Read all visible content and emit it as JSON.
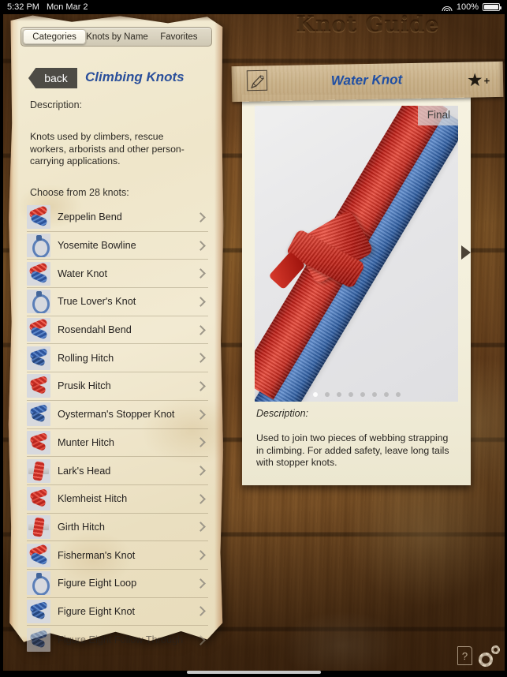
{
  "status_bar": {
    "time": "5:32 PM",
    "date": "Mon Mar 2",
    "wifi_icon": "wifi-icon",
    "battery_percent": "100%",
    "battery_icon": "battery-full-icon"
  },
  "app": {
    "title": "Knot Guide"
  },
  "left_panel": {
    "tabs": [
      {
        "label": "Categories",
        "active": true
      },
      {
        "label": "Knots by Name",
        "active": false
      },
      {
        "label": "Favorites",
        "active": false
      }
    ],
    "back_label": "back",
    "category_title": "Climbing Knots",
    "description_label": "Description:",
    "description_body": "Knots used by climbers, rescue workers, arborists and other person-carrying applications.",
    "choose_label": "Choose from 28 knots:",
    "knot_count": 28,
    "knots": [
      {
        "name": "Zeppelin Bend",
        "thumb": "mixed"
      },
      {
        "name": "Yosemite Bowline",
        "thumb": "loop"
      },
      {
        "name": "Water Knot",
        "thumb": "mixed"
      },
      {
        "name": "True Lover's Knot",
        "thumb": "loop"
      },
      {
        "name": "Rosendahl Bend",
        "thumb": "mixed"
      },
      {
        "name": "Rolling Hitch",
        "thumb": "blue"
      },
      {
        "name": "Prusik Hitch",
        "thumb": "red"
      },
      {
        "name": "Oysterman's Stopper Knot",
        "thumb": "blue"
      },
      {
        "name": "Munter Hitch",
        "thumb": "red"
      },
      {
        "name": "Lark's Head",
        "thumb": "web"
      },
      {
        "name": "Klemheist Hitch",
        "thumb": "red"
      },
      {
        "name": "Girth Hitch",
        "thumb": "web"
      },
      {
        "name": "Fisherman's Knot",
        "thumb": "mixed"
      },
      {
        "name": "Figure Eight Loop",
        "thumb": "loop"
      },
      {
        "name": "Figure Eight Knot",
        "thumb": "blue"
      },
      {
        "name": "Figure Eight Follow Through",
        "thumb": "blue"
      }
    ],
    "chevron_icon": "chevron-right-icon"
  },
  "detail_panel": {
    "edit_icon": "pencil-edit-icon",
    "knot_name": "Water Knot",
    "favorite_icon": "star-plus-icon",
    "favorite_star": "★",
    "favorite_plus": "+",
    "step_badge": "Final",
    "page_dots_total": 8,
    "page_dots_active_index": 0,
    "description_label": "Description:",
    "description_body": "Used to join two pieces of webbing strapping in climbing. For added safety, leave long tails with stopper knots.",
    "next_icon": "next-arrow-icon"
  },
  "footer": {
    "help_icon": "help-question-icon",
    "help_glyph": "?",
    "settings_icon": "gear-settings-icon"
  },
  "colors": {
    "title_blue": "#1f4ea3",
    "wood_brown": "#8a5a2c",
    "parchment": "#f2ead2",
    "strap_red": "#c22018",
    "strap_blue": "#3765ad"
  }
}
